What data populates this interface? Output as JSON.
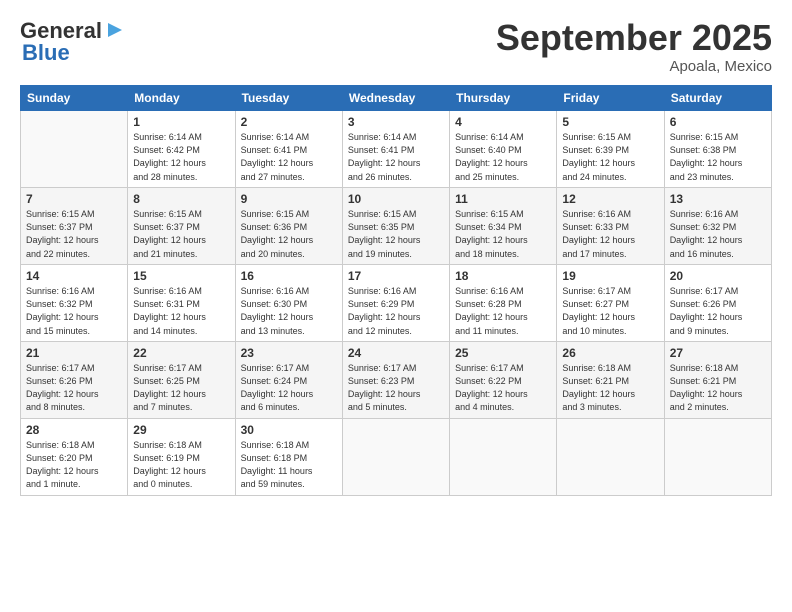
{
  "logo": {
    "line1": "General",
    "line2": "Blue"
  },
  "title": "September 2025",
  "location": "Apoala, Mexico",
  "days_header": [
    "Sunday",
    "Monday",
    "Tuesday",
    "Wednesday",
    "Thursday",
    "Friday",
    "Saturday"
  ],
  "weeks": [
    [
      {
        "num": "",
        "info": ""
      },
      {
        "num": "1",
        "info": "Sunrise: 6:14 AM\nSunset: 6:42 PM\nDaylight: 12 hours\nand 28 minutes."
      },
      {
        "num": "2",
        "info": "Sunrise: 6:14 AM\nSunset: 6:41 PM\nDaylight: 12 hours\nand 27 minutes."
      },
      {
        "num": "3",
        "info": "Sunrise: 6:14 AM\nSunset: 6:41 PM\nDaylight: 12 hours\nand 26 minutes."
      },
      {
        "num": "4",
        "info": "Sunrise: 6:14 AM\nSunset: 6:40 PM\nDaylight: 12 hours\nand 25 minutes."
      },
      {
        "num": "5",
        "info": "Sunrise: 6:15 AM\nSunset: 6:39 PM\nDaylight: 12 hours\nand 24 minutes."
      },
      {
        "num": "6",
        "info": "Sunrise: 6:15 AM\nSunset: 6:38 PM\nDaylight: 12 hours\nand 23 minutes."
      }
    ],
    [
      {
        "num": "7",
        "info": "Sunrise: 6:15 AM\nSunset: 6:37 PM\nDaylight: 12 hours\nand 22 minutes."
      },
      {
        "num": "8",
        "info": "Sunrise: 6:15 AM\nSunset: 6:37 PM\nDaylight: 12 hours\nand 21 minutes."
      },
      {
        "num": "9",
        "info": "Sunrise: 6:15 AM\nSunset: 6:36 PM\nDaylight: 12 hours\nand 20 minutes."
      },
      {
        "num": "10",
        "info": "Sunrise: 6:15 AM\nSunset: 6:35 PM\nDaylight: 12 hours\nand 19 minutes."
      },
      {
        "num": "11",
        "info": "Sunrise: 6:15 AM\nSunset: 6:34 PM\nDaylight: 12 hours\nand 18 minutes."
      },
      {
        "num": "12",
        "info": "Sunrise: 6:16 AM\nSunset: 6:33 PM\nDaylight: 12 hours\nand 17 minutes."
      },
      {
        "num": "13",
        "info": "Sunrise: 6:16 AM\nSunset: 6:32 PM\nDaylight: 12 hours\nand 16 minutes."
      }
    ],
    [
      {
        "num": "14",
        "info": "Sunrise: 6:16 AM\nSunset: 6:32 PM\nDaylight: 12 hours\nand 15 minutes."
      },
      {
        "num": "15",
        "info": "Sunrise: 6:16 AM\nSunset: 6:31 PM\nDaylight: 12 hours\nand 14 minutes."
      },
      {
        "num": "16",
        "info": "Sunrise: 6:16 AM\nSunset: 6:30 PM\nDaylight: 12 hours\nand 13 minutes."
      },
      {
        "num": "17",
        "info": "Sunrise: 6:16 AM\nSunset: 6:29 PM\nDaylight: 12 hours\nand 12 minutes."
      },
      {
        "num": "18",
        "info": "Sunrise: 6:16 AM\nSunset: 6:28 PM\nDaylight: 12 hours\nand 11 minutes."
      },
      {
        "num": "19",
        "info": "Sunrise: 6:17 AM\nSunset: 6:27 PM\nDaylight: 12 hours\nand 10 minutes."
      },
      {
        "num": "20",
        "info": "Sunrise: 6:17 AM\nSunset: 6:26 PM\nDaylight: 12 hours\nand 9 minutes."
      }
    ],
    [
      {
        "num": "21",
        "info": "Sunrise: 6:17 AM\nSunset: 6:26 PM\nDaylight: 12 hours\nand 8 minutes."
      },
      {
        "num": "22",
        "info": "Sunrise: 6:17 AM\nSunset: 6:25 PM\nDaylight: 12 hours\nand 7 minutes."
      },
      {
        "num": "23",
        "info": "Sunrise: 6:17 AM\nSunset: 6:24 PM\nDaylight: 12 hours\nand 6 minutes."
      },
      {
        "num": "24",
        "info": "Sunrise: 6:17 AM\nSunset: 6:23 PM\nDaylight: 12 hours\nand 5 minutes."
      },
      {
        "num": "25",
        "info": "Sunrise: 6:17 AM\nSunset: 6:22 PM\nDaylight: 12 hours\nand 4 minutes."
      },
      {
        "num": "26",
        "info": "Sunrise: 6:18 AM\nSunset: 6:21 PM\nDaylight: 12 hours\nand 3 minutes."
      },
      {
        "num": "27",
        "info": "Sunrise: 6:18 AM\nSunset: 6:21 PM\nDaylight: 12 hours\nand 2 minutes."
      }
    ],
    [
      {
        "num": "28",
        "info": "Sunrise: 6:18 AM\nSunset: 6:20 PM\nDaylight: 12 hours\nand 1 minute."
      },
      {
        "num": "29",
        "info": "Sunrise: 6:18 AM\nSunset: 6:19 PM\nDaylight: 12 hours\nand 0 minutes."
      },
      {
        "num": "30",
        "info": "Sunrise: 6:18 AM\nSunset: 6:18 PM\nDaylight: 11 hours\nand 59 minutes."
      },
      {
        "num": "",
        "info": ""
      },
      {
        "num": "",
        "info": ""
      },
      {
        "num": "",
        "info": ""
      },
      {
        "num": "",
        "info": ""
      }
    ]
  ]
}
